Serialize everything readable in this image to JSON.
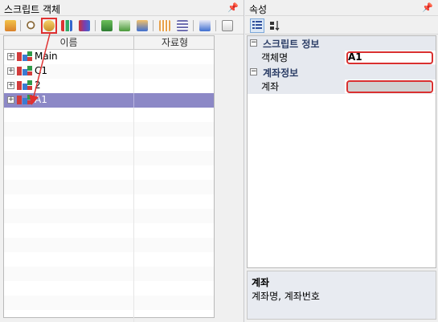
{
  "left_panel": {
    "title": "스크립트 객체",
    "pin": "📌",
    "columns": [
      "이름",
      "자료형"
    ],
    "items": [
      {
        "name": "Main",
        "type": ""
      },
      {
        "name": "C1",
        "type": ""
      },
      {
        "name": "2",
        "type": ""
      },
      {
        "name": "A1",
        "type": ""
      }
    ],
    "selected_index": 3,
    "toolbar_icons": [
      "run-script-icon",
      "find-icon",
      "add-account-icon",
      "add-chart-icon",
      "add-order-icon",
      "open-icon",
      "check-icon",
      "save-icon",
      "calendar-icon",
      "list-icon",
      "export-icon",
      "close-table-icon"
    ]
  },
  "right_panel": {
    "title": "속성",
    "pin": "📌",
    "sections": [
      {
        "label": "스크립트 정보",
        "props": [
          {
            "name": "객체명",
            "value": "A1"
          }
        ]
      },
      {
        "label": "계좌정보",
        "props": [
          {
            "name": "계좌",
            "value": ""
          }
        ]
      }
    ],
    "description": {
      "title": "계좌",
      "text": "계좌명, 계좌번호"
    }
  },
  "colors": {
    "highlight": "#e03030",
    "selection": "#8c88c6",
    "category_text": "#2b3d66"
  }
}
